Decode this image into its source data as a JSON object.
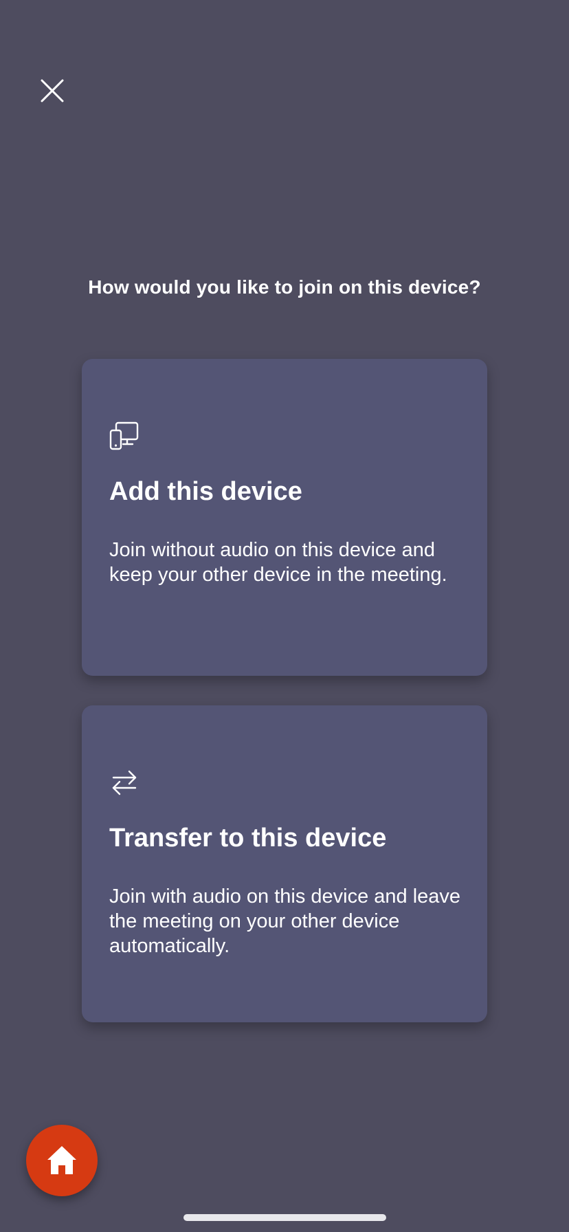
{
  "header": {
    "close_icon": "close-icon"
  },
  "prompt": {
    "question": "How would you like to join on this device?"
  },
  "options": [
    {
      "icon": "devices-icon",
      "title": "Add this device",
      "description": "Join without audio on this device and keep your other device in the meeting."
    },
    {
      "icon": "transfer-arrows-icon",
      "title": "Transfer to this device",
      "description": "Join with audio on this device and leave the meeting on your other device automatically."
    }
  ],
  "fab": {
    "icon": "home-icon",
    "color": "#d63a12"
  },
  "colors": {
    "background": "#4e4c5f",
    "card": "#545575",
    "text": "#ffffff"
  }
}
